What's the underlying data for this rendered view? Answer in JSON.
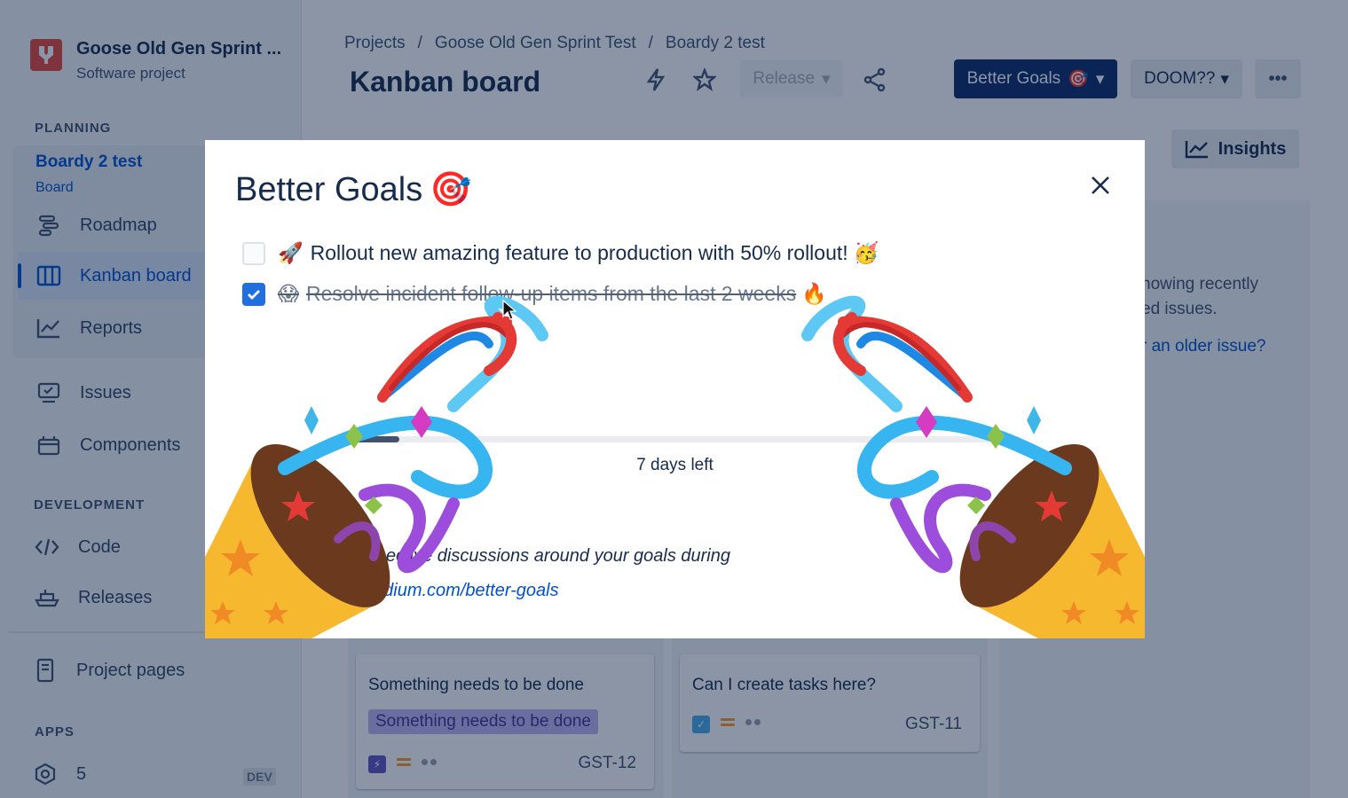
{
  "sidebar": {
    "project_name": "Goose Old Gen Sprint ...",
    "project_type": "Software project",
    "planning_header": "PLANNING",
    "board_title": "Boardy 2 test",
    "board_subtitle": "Board",
    "planning_items": [
      {
        "label": "Roadmap",
        "icon": "roadmap-icon"
      },
      {
        "label": "Kanban board",
        "icon": "board-columns-icon",
        "active": true
      },
      {
        "label": "Reports",
        "icon": "chart-line-icon"
      }
    ],
    "other_items": [
      {
        "label": "Issues",
        "icon": "issues-monitor-icon"
      },
      {
        "label": "Components",
        "icon": "components-icon"
      }
    ],
    "development_header": "DEVELOPMENT",
    "development_items": [
      {
        "label": "Code",
        "icon": "code-icon"
      },
      {
        "label": "Releases",
        "icon": "ship-icon"
      }
    ],
    "project_pages": "Project pages",
    "apps_header": "APPS",
    "app_item": {
      "label": "5",
      "badge": "DEV",
      "icon": "hexagon-icon"
    }
  },
  "header": {
    "breadcrumbs": [
      "Projects",
      "/",
      "Goose Old Gen Sprint Test",
      "/",
      "Boardy 2 test"
    ],
    "title": "Kanban board",
    "release_label": "Release",
    "goals_button": "Better Goals",
    "doom_button": "DOOM??",
    "insights_button": "Insights"
  },
  "right_panel": {
    "line1": "howing recently",
    "line2": "ed issues.",
    "link": "r an older issue?"
  },
  "cards": [
    {
      "title": "Something needs to be done",
      "tag": "Something needs to be done",
      "key": "GST-12"
    },
    {
      "title": "Can I create tasks here?",
      "key": "GST-11"
    }
  ],
  "modal": {
    "title": "Better Goals",
    "title_emoji": "🎯",
    "goals": [
      {
        "prefix": "🚀",
        "text": "Rollout new amazing feature to production with 50% rollout!",
        "suffix": "🥳",
        "done": false
      },
      {
        "prefix": "😱",
        "text": "Resolve incident follow-up items from the last 2 weeks",
        "suffix": "🔥",
        "done": true
      }
    ],
    "progress": 0.08,
    "days_left": "7 days left",
    "footer_text": "ective discussions around your goals during",
    "footer_link": "edium.com/better-goals"
  },
  "colors": {
    "primary": "#0052cc",
    "goals_button": "#0c2a66",
    "checkbox_checked": "#1f6fe0",
    "project_logo": "#e5493a"
  }
}
